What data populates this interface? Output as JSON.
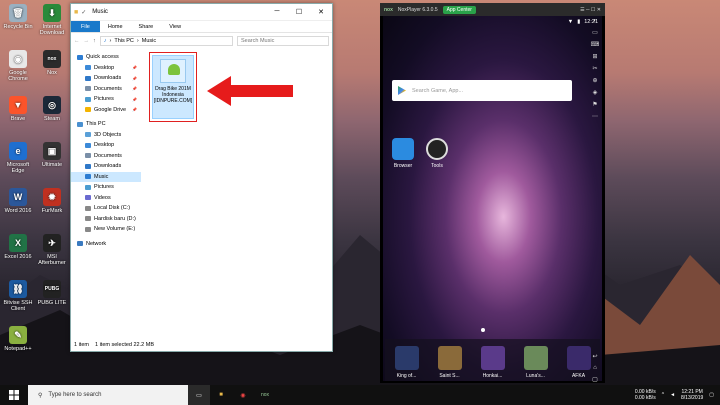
{
  "desktop": {
    "icons": [
      {
        "label": "Recycle Bin",
        "color": "#9ab0c0",
        "glyph": "🗑"
      },
      {
        "label": "Internet Download",
        "color": "#2a8a3a",
        "glyph": "⬇"
      },
      {
        "label": "Google Chrome",
        "color": "#e8e8e8",
        "glyph": "◉"
      },
      {
        "label": "Nox",
        "color": "#2b2b2b",
        "glyph": "nox"
      },
      {
        "label": "Brave",
        "color": "#fb542b",
        "glyph": "▼"
      },
      {
        "label": "Steam",
        "color": "#1b2838",
        "glyph": "◎"
      },
      {
        "label": "Microsoft Edge",
        "color": "#1e6fd0",
        "glyph": "e"
      },
      {
        "label": "Ultimate",
        "color": "#333",
        "glyph": "▣"
      },
      {
        "label": "Word 2016",
        "color": "#2b579a",
        "glyph": "W"
      },
      {
        "label": "FurMark",
        "color": "#c03020",
        "glyph": "✹"
      },
      {
        "label": "Excel 2016",
        "color": "#217346",
        "glyph": "X"
      },
      {
        "label": "MSI Afterburner",
        "color": "#222",
        "glyph": "✈"
      },
      {
        "label": "Bitvise SSH Client",
        "color": "#1c5aa0",
        "glyph": "⛓"
      },
      {
        "label": "PUBG LITE",
        "color": "#222",
        "glyph": "PUBG"
      },
      {
        "label": "Notepad++",
        "color": "#8ab040",
        "glyph": "✎"
      }
    ]
  },
  "explorer": {
    "title": "Music",
    "ribbon": {
      "file": "File",
      "home": "Home",
      "share": "Share",
      "view": "View"
    },
    "window_buttons": {
      "minimize": "─",
      "maximize": "☐",
      "close": "✕"
    },
    "address": {
      "this_pc": "This PC",
      "music": "Music",
      "sep": "›"
    },
    "search_placeholder": "Search Music",
    "nav": [
      {
        "label": "Quick access",
        "color": "#2d7dd2",
        "pinned": false
      },
      {
        "label": "Desktop",
        "color": "#3c8ad8",
        "pinned": true
      },
      {
        "label": "Downloads",
        "color": "#2f78c8",
        "pinned": true
      },
      {
        "label": "Documents",
        "color": "#7a8fa8",
        "pinned": true
      },
      {
        "label": "Pictures",
        "color": "#4a9cd0",
        "pinned": true
      },
      {
        "label": "Google Drive",
        "color": "#f4b400",
        "pinned": true
      },
      {
        "label": "This PC",
        "color": "#4a90d0",
        "pinned": false
      },
      {
        "label": "3D Objects",
        "color": "#5aa0d8",
        "pinned": false
      },
      {
        "label": "Desktop",
        "color": "#3c8ad8",
        "pinned": false
      },
      {
        "label": "Documents",
        "color": "#7a8fa8",
        "pinned": false
      },
      {
        "label": "Downloads",
        "color": "#2f78c8",
        "pinned": false
      },
      {
        "label": "Music",
        "color": "#2d7dd2",
        "pinned": false,
        "selected": true
      },
      {
        "label": "Pictures",
        "color": "#4a9cd0",
        "pinned": false
      },
      {
        "label": "Videos",
        "color": "#6a6ad0",
        "pinned": false
      },
      {
        "label": "Local Disk (C:)",
        "color": "#888",
        "pinned": false
      },
      {
        "label": "Hardisk baru (D:)",
        "color": "#888",
        "pinned": false
      },
      {
        "label": "New Volume (E:)",
        "color": "#888",
        "pinned": false
      },
      {
        "label": "Network",
        "color": "#3a7ac0",
        "pinned": false
      }
    ],
    "file": {
      "name_line1": "Drag Bike 201M",
      "name_line2": "Indonesia",
      "name_line3": "[IDNPURE.COM]"
    },
    "status": {
      "count": "1 item",
      "selected": "1 item selected  22.2 MB"
    }
  },
  "nox": {
    "logo": "nox",
    "title": "NoxPlayer 6.3.0.5",
    "app_center": "App Center",
    "time": "12:21",
    "search_placeholder": "Search Game, App...",
    "home": [
      {
        "label": "Browser",
        "color": "#2b8be0"
      },
      {
        "label": "Tools",
        "color": "#222"
      }
    ],
    "dock": [
      {
        "label": "King of...",
        "color": "#2a3a6a"
      },
      {
        "label": "Saint S...",
        "color": "#8a6a3a"
      },
      {
        "label": "Honkai...",
        "color": "#5a3a8a"
      },
      {
        "label": "Luna's...",
        "color": "#6a8a5a"
      },
      {
        "label": "AFKA",
        "color": "#3a2a6a"
      }
    ]
  },
  "taskbar": {
    "search_placeholder": "Type here to search",
    "network": "0.00 kB/s\n0.00 kB/s",
    "time": "12:21 PM",
    "date": "8/13/2019"
  }
}
